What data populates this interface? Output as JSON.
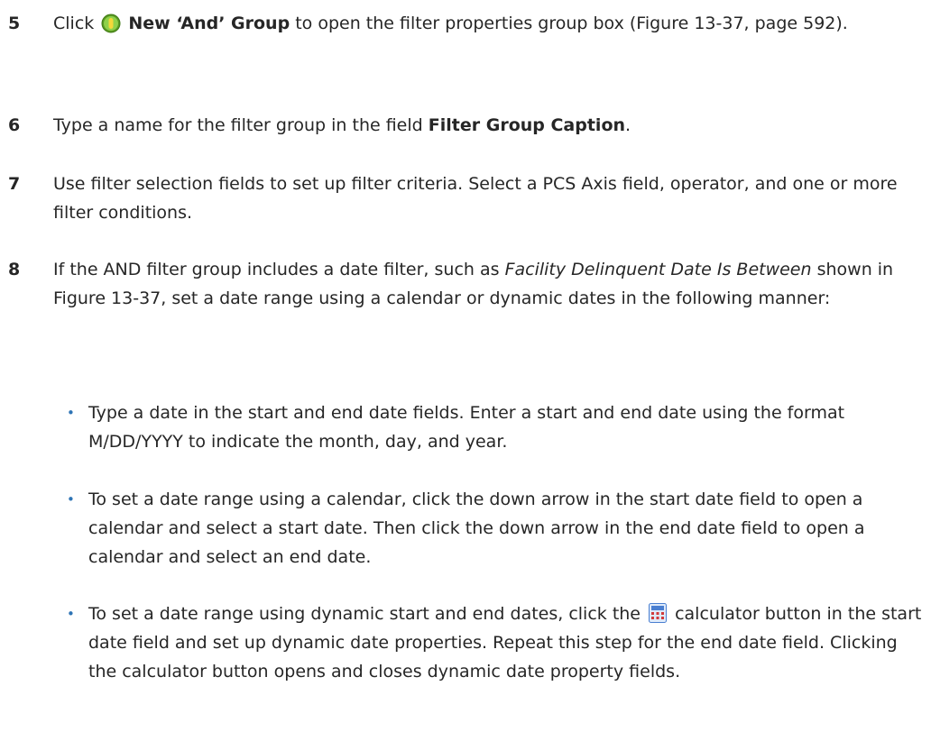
{
  "steps": [
    {
      "num": "5",
      "lead": "Click",
      "icon": "and-group-icon",
      "button_label": "New ‘And’ Group",
      "rest": "to open the filter properties group box (Figure 13-37, page 592)."
    },
    {
      "num": "6",
      "lead": "Type a name for the filter group in the field",
      "field_name": "Filter Group Caption",
      "tail": "."
    },
    {
      "num": "7",
      "text": "Use filter selection fields to set up filter criteria. Select a PCS Axis field, operator, and one or more filter conditions."
    },
    {
      "num": "8",
      "lead": "If the AND filter group includes a date filter, such as",
      "italic": "Facility Delinquent Date Is Between",
      "rest": "shown in Figure 13-37, set a date range using a calendar or dynamic dates in the following manner:"
    }
  ],
  "bullets": [
    {
      "marker": "•",
      "text": "Type a date in the start and end date fields. Enter a start and end date using the format M/DD/YYYY to indicate the month, day, and year."
    },
    {
      "marker": "•",
      "text": "To set a date range using a calendar, click the down arrow in the start date field to open a calendar and select a start date. Then click the down arrow in the end date field to open a calendar and select an end date."
    },
    {
      "marker": "•",
      "lead": "To set a date range using dynamic start and end dates, click the",
      "icon": "calculator-icon",
      "rest": "calculator button in the start date field and set up dynamic date properties. Repeat this step for the end date field. Clicking the calculator button opens and closes dynamic date property fields."
    }
  ],
  "colors": {
    "text": "#262626",
    "bullet": "#2e74b5",
    "and_icon": "#7cc43a",
    "calculator_icon": "#4a7fd1"
  }
}
